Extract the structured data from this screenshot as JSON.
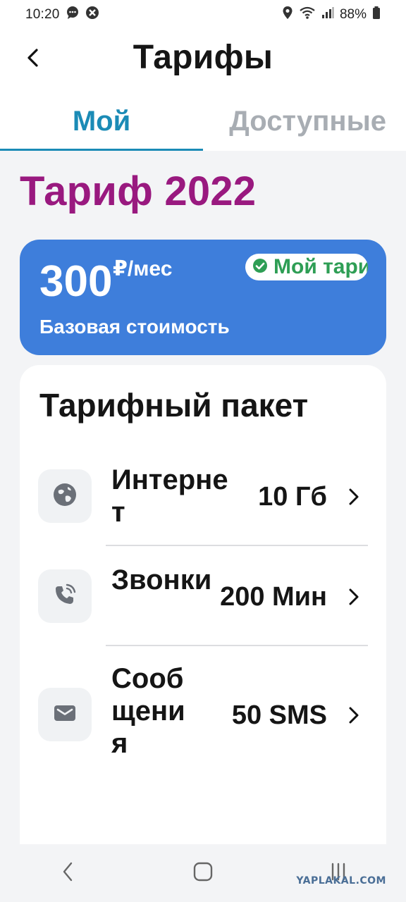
{
  "status_bar": {
    "time": "10:20",
    "battery": "88%",
    "icons": [
      "chat-bubble-icon",
      "close-circle-icon",
      "location-icon",
      "wifi-icon",
      "signal-icon",
      "battery-icon"
    ]
  },
  "header": {
    "title": "Тарифы",
    "back_icon": "back-arrow-icon"
  },
  "tabs": [
    {
      "label": "Мой",
      "active": true
    },
    {
      "label": "Доступные",
      "active": false
    }
  ],
  "tariff": {
    "name": "Тариф 2022",
    "price": "300",
    "price_unit": "₽/мес",
    "price_caption": "Базовая стоимость",
    "badge": "Мой тариф"
  },
  "package": {
    "title": "Тарифный пакет",
    "items": [
      {
        "label": "Интернет",
        "value": "10 Гб",
        "icon": "globe-icon"
      },
      {
        "label": "Звонки",
        "value": "200 Мин",
        "icon": "phone-call-icon"
      },
      {
        "label": "Сообщения",
        "value": "50 SMS",
        "icon": "envelope-icon"
      }
    ]
  },
  "nav": {
    "icons": [
      "nav-back-icon",
      "nav-home-icon",
      "nav-recents-icon"
    ]
  },
  "watermark": "YAPLAKAL.COM",
  "colors": {
    "accent": "#1b8bb6",
    "tariff_name": "#99197f",
    "price_card": "#3e7edb",
    "badge_text": "#2e9e55"
  }
}
